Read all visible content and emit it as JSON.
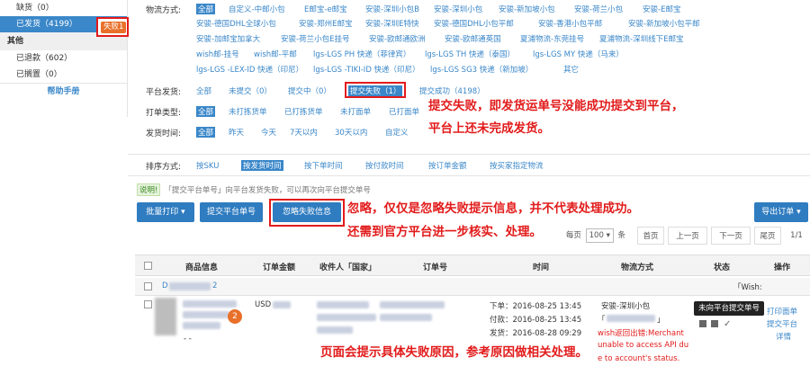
{
  "sidebar": {
    "items": [
      {
        "label": "缺货（0）"
      },
      {
        "label": "已发货（4199）"
      },
      {
        "label": "其他"
      },
      {
        "label": "已退款（602）"
      },
      {
        "label": "已搁置（0）"
      },
      {
        "label": "帮助手册"
      }
    ],
    "fail_badge": "失败1"
  },
  "filters": {
    "ship_method_label": "物流方式:",
    "ship_methods_row1": [
      "全部",
      "自定义-中邮小包",
      "E邮宝-e邮宝",
      "安骏-深圳小包B",
      "安骏-深圳小包",
      "安骏-新加坡小包",
      "安骏-荷兰小包",
      "安骏-E邮宝"
    ],
    "ship_methods_row2": [
      "安骏-德国DHL全球小包",
      "安骏-郑州E邮宝",
      "安骏-深圳E特快",
      "安骏-德国DHL小包平邮",
      "安骏-香港小包平邮",
      "安骏-新加坡小包平邮"
    ],
    "ship_methods_row3": [
      "安骏-加邮宝加拿大",
      "安骏-荷兰小包E挂号",
      "安骏-欧邮通欧洲",
      "安骏-欧邮通英国",
      "夏浦物流-东莞挂号",
      "夏浦物流-深圳线下E邮宝"
    ],
    "ship_methods_row4": [
      "wish邮-挂号",
      "wish邮-平邮",
      "lgs-LGS PH 快递（菲律宾）",
      "lgs-LGS TH 快递（泰国）",
      "lgs-LGS MY 快递（马来）"
    ],
    "ship_methods_row5": [
      "lgs-LGS -LEX-ID 快递（印尼）",
      "lgs-LGS -TIKI-ID 快递（印尼）",
      "lgs-LGS SG3 快递（新加坡）",
      "其它"
    ],
    "platform_label": "平台发货:",
    "platform_options": [
      "全部",
      "未提交（0）",
      "提交中（0）",
      "提交失败（1）",
      "提交成功（4198）"
    ],
    "print_label": "打单类型:",
    "print_options": [
      "全部",
      "未打拣货单",
      "已打拣货单",
      "未打面单",
      "已打面单"
    ],
    "ship_time_label": "发货时间:",
    "ship_time_options": [
      "全部",
      "昨天",
      "今天",
      "7天以内",
      "30天以内",
      "自定义"
    ]
  },
  "sort": {
    "label": "排序方式:",
    "options": [
      "按SKU",
      "按发货时间",
      "按下单时间",
      "按付款时间",
      "按订单金额",
      "按买家指定物流"
    ]
  },
  "tip": {
    "tag": "说明!",
    "text": "「提交平台单号」向平台发货失败，可以再次向平台提交单号"
  },
  "toolbar": {
    "batch_print": "批量打印 ▾",
    "submit_platform": "提交平台单号",
    "ignore_fail": "忽略失败信息",
    "export": "导出订单 ▾"
  },
  "pager": {
    "per_page": "每页",
    "size": "100",
    "unit": "条",
    "first": "首页",
    "prev": "上一页",
    "next": "下一页",
    "last": "尾页",
    "page": "1/1"
  },
  "table": {
    "headers": [
      "商品信息",
      "订单金额",
      "收件人「国家」",
      "订单号",
      "时间",
      "物流方式",
      "状态",
      "操作"
    ],
    "order_id_prefix": "D",
    "order_id_suffix": "2",
    "store": "「Wish:",
    "qty_badge": "2",
    "amount_prefix": "USD",
    "times": [
      "下单：2016-08-25 13:45",
      "付款：2016-08-25 13:45",
      "发货：2016-08-28 09:29"
    ],
    "ship_method": "安骏-深圳小包",
    "ship_bracket_open": "「",
    "ship_bracket_close": "」",
    "error_lines": [
      "wish返回出错:Merchant",
      "unable to access API du",
      "e to account's status."
    ],
    "tooltip": "未向平台提交单号",
    "ops": [
      "打印面单",
      "提交平台",
      "详情"
    ],
    "dash": "- -"
  },
  "annotations": {
    "a1_line1": "提交失败，即发货运单号没能成功提交到平台，",
    "a1_line2": "平台上还未完成发货。",
    "a2_line1": "忽略，仅仅是忽略失败提示信息，并不代表处理成功。",
    "a2_line2": "还需到官方平台进一步核实、处理。",
    "a3": "页面会提示具体失败原因，参考原因做相关处理。"
  },
  "colors": {
    "primary": "#3a87c9",
    "button": "#2f7cc0",
    "annotation": "#e21b1b",
    "badge": "#e8702a"
  }
}
